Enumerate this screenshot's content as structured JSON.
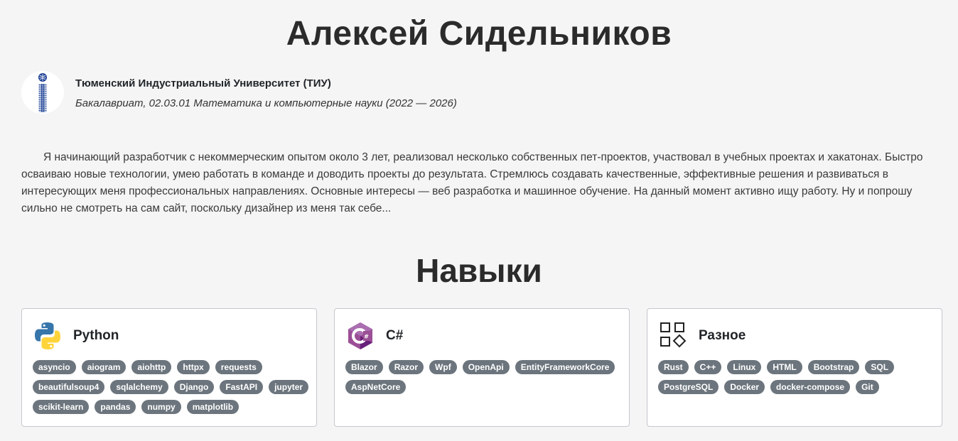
{
  "profile": {
    "name": "Алексей Сидельников",
    "university": "Тюменский Индустриальный Университет (ТИУ)",
    "degree": "Бакалавриат, 02.03.01 Математика и компьютерные науки (2022 — 2026)",
    "about": "Я начинающий разработчик с некоммерческим опытом около 3 лет, реализовал несколько собственных пет-проектов, участвовал в учебных проектах и хакатонах. Быстро осваиваю новые технологии, умею работать в команде и доводить проекты до результата. Стремлюсь создавать качественные, эффективные решения и развиваться в интересующих меня профессиональных направлениях. Основные интересы — веб разработка и машинное обучение. На данный момент активно ищу работу. Ну и попрошу сильно не смотреть на сам сайт, поскольку дизайнер из меня так себе..."
  },
  "skills": {
    "title": "Навыки",
    "cards": [
      {
        "title": "Python",
        "icon": "python-logo-icon",
        "tags": [
          "asyncio",
          "aiogram",
          "aiohttp",
          "httpx",
          "requests",
          "beautifulsoup4",
          "sqlalchemy",
          "Django",
          "FastAPI",
          "jupyter",
          "scikit-learn",
          "pandas",
          "numpy",
          "matplotlib"
        ]
      },
      {
        "title": "C#",
        "icon": "csharp-logo-icon",
        "tags": [
          "Blazor",
          "Razor",
          "Wpf",
          "OpenApi",
          "EntityFrameworkCore",
          "AspNetCore"
        ]
      },
      {
        "title": "Разное",
        "icon": "shapes-icon",
        "tags": [
          "Rust",
          "C++",
          "Linux",
          "HTML",
          "Bootstrap",
          "SQL",
          "PostgreSQL",
          "Docker",
          "docker-compose",
          "Git"
        ]
      }
    ]
  },
  "colors": {
    "background": "#f5f5f5",
    "tag": "#6c757d",
    "card_border": "#c6c6ce",
    "python_blue": "#3776ab",
    "python_yellow": "#ffd43b",
    "csharp_purple": "#9b4f96",
    "university_blue": "#1c3f94"
  }
}
